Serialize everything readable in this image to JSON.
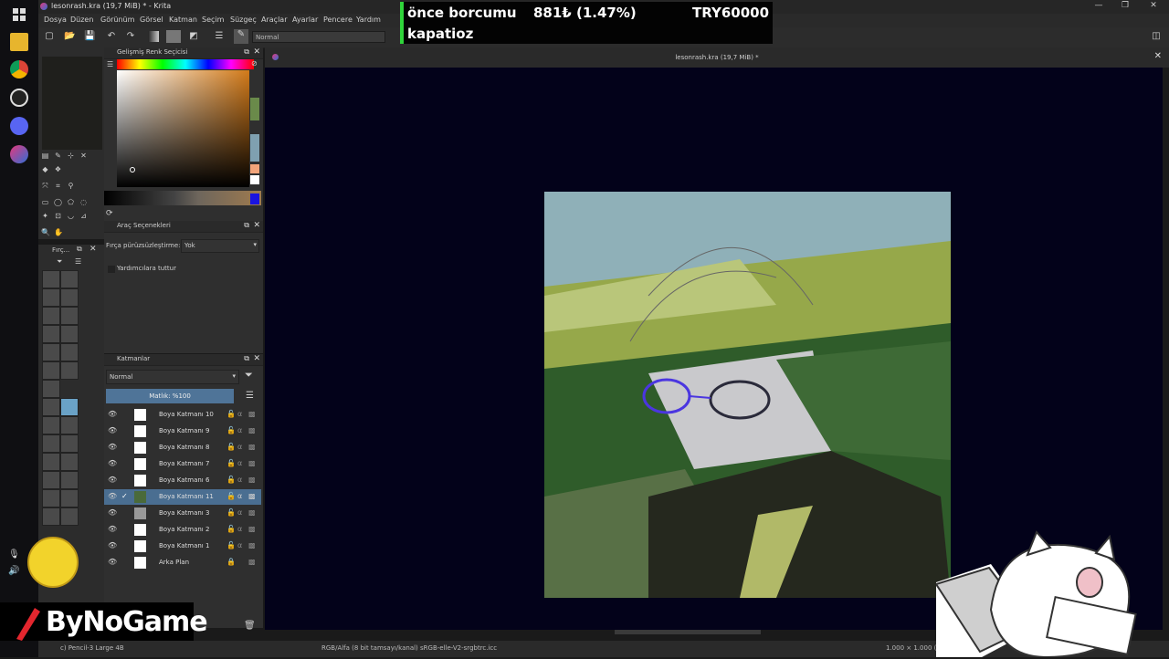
{
  "window": {
    "title": "lesonrash.kra (19,7 MiB) * - Krita"
  },
  "menu": [
    "Dosya",
    "Düzen",
    "Görünüm",
    "Görsel",
    "Katman",
    "Seçim",
    "Süzgeç",
    "Araçlar",
    "Ayarlar",
    "Pencere",
    "Yardım"
  ],
  "toolbar": {
    "blend_mode": "Normal"
  },
  "ticker": {
    "line1": "önce borcumu",
    "value": "881₺ (1.47%)",
    "target": "TRY60000",
    "line2": "kapatioz"
  },
  "docker_color": {
    "title": "Gelişmiş Renk Seçicisi"
  },
  "docker_tool_options": {
    "title": "Araç Seçenekleri",
    "smoothing_label": "Fırça pürüzsüzleştirme:",
    "smoothing_value": "Yok",
    "assist_label": "Yardımcılara tuttur"
  },
  "docker_brushes": {
    "title": "Fırç..."
  },
  "docker_layers": {
    "title": "Katmanlar",
    "blend": "Normal",
    "opacity": "Matlık: %100",
    "layers": [
      {
        "name": "Boya Katmanı 10"
      },
      {
        "name": "Boya Katmanı 9"
      },
      {
        "name": "Boya Katmanı 8"
      },
      {
        "name": "Boya Katmanı 7"
      },
      {
        "name": "Boya Katmanı 6"
      },
      {
        "name": "Boya Katmanı 11"
      },
      {
        "name": "Boya Katmanı 3"
      },
      {
        "name": "Boya Katmanı 2"
      },
      {
        "name": "Boya Katmanı 1"
      },
      {
        "name": "Arka Plan"
      }
    ]
  },
  "document": {
    "tab_title": "lesonrash.kra (19,7 MiB) *"
  },
  "status": {
    "brush": "c) Pencil-3 Large 4B",
    "color_profile": "RGB/Alfa (8 bit tamsayı/kanal) sRGB-elle-V2-srgbtrc.icc",
    "size": "1.000 × 1.000 (1"
  },
  "overlay": {
    "logo_text": "ByNoGame"
  },
  "colors": {
    "selected_layer": "#4a6e91",
    "canvas_bg": "#03021a",
    "ticker_accent": "#2fd43a"
  }
}
